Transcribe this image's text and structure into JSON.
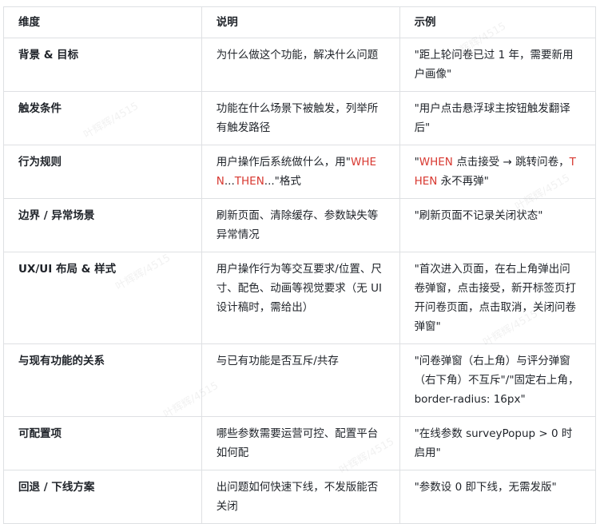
{
  "table": {
    "headers": [
      "维度",
      "说明",
      "示例"
    ],
    "rows": [
      {
        "dim": "背景 & 目标",
        "desc": "为什么做这个功能，解决什么问题",
        "example": "\"距上轮问卷已过 1 年，需要新用户画像\""
      },
      {
        "dim": "触发条件",
        "desc": "功能在什么场景下被触发，列举所有触发路径",
        "example": "\"用户点击悬浮球主按钮触发翻译后\""
      },
      {
        "dim": "行为规则",
        "desc_parts": [
          "用户操作后系统做什么，用\"",
          "WHEN",
          "...",
          "THEN",
          "...\"格式"
        ],
        "example_parts": [
          "\"",
          "WHEN",
          " 点击接受 → 跳转问卷，",
          "THEN",
          " 永不再弹\""
        ]
      },
      {
        "dim": "边界 / 异常场景",
        "desc": "刷新页面、清除缓存、参数缺失等异常情况",
        "example": "\"刷新页面不记录关闭状态\""
      },
      {
        "dim": "UX/UI 布局 & 样式",
        "desc": "用户操作行为等交互要求/位置、尺寸、配色、动画等视觉要求（无 UI 设计稿时，需给出）",
        "example": "\"首次进入页面，在右上角弹出问卷弹窗，点击接受，新开标签页打开问卷页面，点击取消，关闭问卷弹窗\""
      },
      {
        "dim": "与现有功能的关系",
        "desc": "与已有功能是否互斥/共存",
        "example": "\"问卷弹窗（右上角）与评分弹窗（右下角）不互斥\"/\"固定右上角，border-radius: 16px\""
      },
      {
        "dim": "可配置项",
        "desc": "哪些参数需要运营可控、配置平台如何配",
        "example": "\"在线参数 surveyPopup > 0 时启用\""
      },
      {
        "dim": "回退 / 下线方案",
        "desc": "出问题如何快速下线，不发版能否关闭",
        "example": "\"参数设 0 即下线，无需发版\""
      }
    ]
  },
  "watermark": {
    "text": "叶辉辉/4515"
  },
  "colors": {
    "keyword": "#d83931",
    "border": "#dee0e3",
    "text": "#1f2329"
  }
}
